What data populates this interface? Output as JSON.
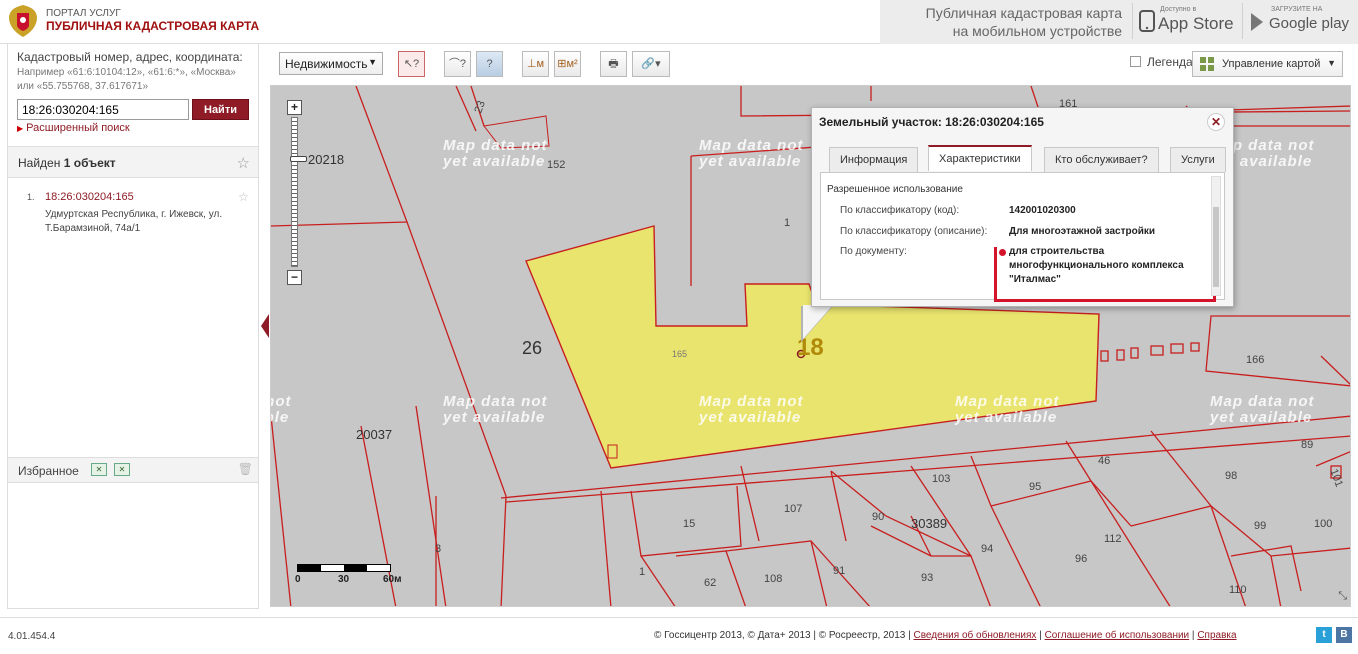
{
  "header": {
    "portal_small": "ПОРТАЛ УСЛУГ",
    "portal_title": "ПУБЛИЧНАЯ КАДАСТРОВАЯ КАРТА",
    "mobile_line1": "Публичная кадастровая карта",
    "mobile_line2": "на мобильном устройстве",
    "appstore_small": "Доступно в",
    "appstore_big": "App Store",
    "googleplay_small": "ЗАГРУЗИТЕ НА",
    "googleplay_big": "Google play"
  },
  "search": {
    "title": "Кадастровый номер, адрес, координата:",
    "example": "Например «61:6:10104:12», «61:6:*», «Москва» или «55.755768, 37.617671»",
    "value": "18:26:030204:165",
    "button": "Найти",
    "advanced": "Расширенный поиск"
  },
  "results": {
    "found_prefix": "Найден",
    "found_count": "1",
    "found_suffix": "объект",
    "items": [
      {
        "num": "1.",
        "cad": "18:26:030204:165",
        "address": "Удмуртская Республика, г. Ижевск, ул. Т.Барамзиной, 74а/1"
      }
    ]
  },
  "favorites": {
    "label": "Избранное"
  },
  "toolbar": {
    "select_value": "Недвижимость",
    "legend": "Легенда",
    "map_control": "Управление картой"
  },
  "map": {
    "watermark": "Map data not\nyet available",
    "scale": [
      "0",
      "30",
      "60м"
    ],
    "labels": {
      "q20218": "20218",
      "q26": "26",
      "q20037": "20037",
      "q30389": "30389",
      "cad18": "18",
      "p152": "152",
      "p23": "23",
      "p1a": "1",
      "p165": "165",
      "p161": "161",
      "p166": "166",
      "p89": "89",
      "p46": "46",
      "p98": "98",
      "p101": "101",
      "p103": "103",
      "p95": "95",
      "p107": "107",
      "p90": "90",
      "p15": "15",
      "p112": "112",
      "p99": "99",
      "p100": "100",
      "p94": "94",
      "p96": "96",
      "p3": "3",
      "p1b": "1",
      "p62": "62",
      "p108": "108",
      "p91": "91",
      "p93": "93",
      "p110": "110"
    }
  },
  "popup": {
    "title": "Земельный участок: 18:26:030204:165",
    "tabs": [
      "Информация",
      "Характеристики",
      "Кто обслуживает?",
      "Услуги"
    ],
    "section": "Разрешенное использование",
    "rows": [
      {
        "key": "По классификатору (код):",
        "value": "142001020300"
      },
      {
        "key": "По классификатору (описание):",
        "value": "Для многоэтажной застройки"
      },
      {
        "key": "По документу:",
        "value_lines": [
          "для строительства",
          "многофункционального комплекса",
          "\"Италмас\""
        ]
      }
    ]
  },
  "footer": {
    "version": "4.01.454.4",
    "copyright": "© Госсицентр 2013, © Дата+ 2013 | © Росреестр, 2013 |",
    "link_updates": "Сведения об обновлениях",
    "link_terms": "Соглашение об использовании",
    "link_help": "Справка"
  },
  "colors": {
    "brand": "#8e1b25",
    "map_bg": "#c7c7c7",
    "parcel_highlight": "#e8e46e",
    "parcel_border": "#c81e1e",
    "annotation": "#d4142a"
  }
}
